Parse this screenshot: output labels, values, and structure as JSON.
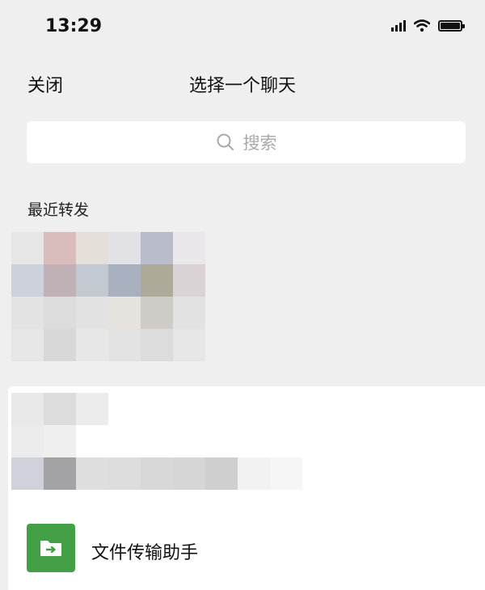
{
  "status_bar": {
    "time": "13:29",
    "icons": [
      "cellular-signal-icon",
      "wifi-icon",
      "battery-icon"
    ]
  },
  "nav": {
    "close_label": "关闭",
    "title": "选择一个聊天"
  },
  "search": {
    "placeholder": "搜索",
    "icon": "search-icon"
  },
  "recent": {
    "section_label": "最近转发"
  },
  "chats": [
    {
      "name": "文件传输助手",
      "icon": "file-transfer-icon",
      "icon_color": "#43a047"
    }
  ],
  "colors": {
    "background": "#efefef",
    "panel": "#ffffff",
    "file_assistant_green": "#43a047"
  }
}
